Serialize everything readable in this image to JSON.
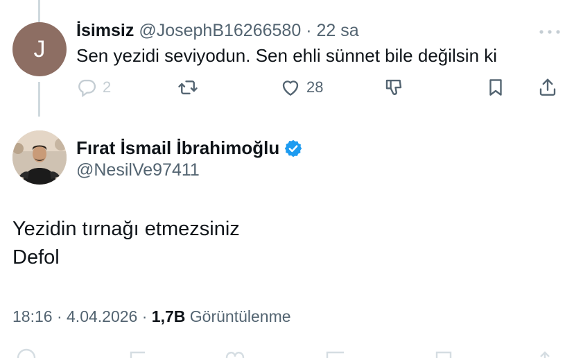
{
  "reply": {
    "avatar_letter": "J",
    "name": "İsimsiz",
    "handle": "@JosephB16266580",
    "separator": "·",
    "time": "22 sa",
    "text": "Sen yezidi seviyodun. Sen ehli sünnet bile değilsin ki",
    "reply_count": "2",
    "like_count": "28"
  },
  "tweet": {
    "name": "Fırat İsmail İbrahimoğlu",
    "handle": "@NesilVe97411",
    "lines": [
      "Yezidin tırnağı etmezsiniz",
      "Defol"
    ],
    "time": "18:16",
    "dot1": "·",
    "date": "4.04.2026",
    "dot2": "·",
    "views": "1,7B",
    "views_label": "Görüntülenme"
  },
  "colors": {
    "text": "#0f1419",
    "muted": "#536471",
    "verified": "#1d9bf0",
    "thread_line": "#cfd9de",
    "avatar_j": "#8d6e63"
  },
  "icons": [
    "more-icon",
    "reply-icon",
    "retweet-icon",
    "like-icon",
    "dislike-icon",
    "bookmark-icon",
    "share-icon",
    "verified-icon"
  ]
}
